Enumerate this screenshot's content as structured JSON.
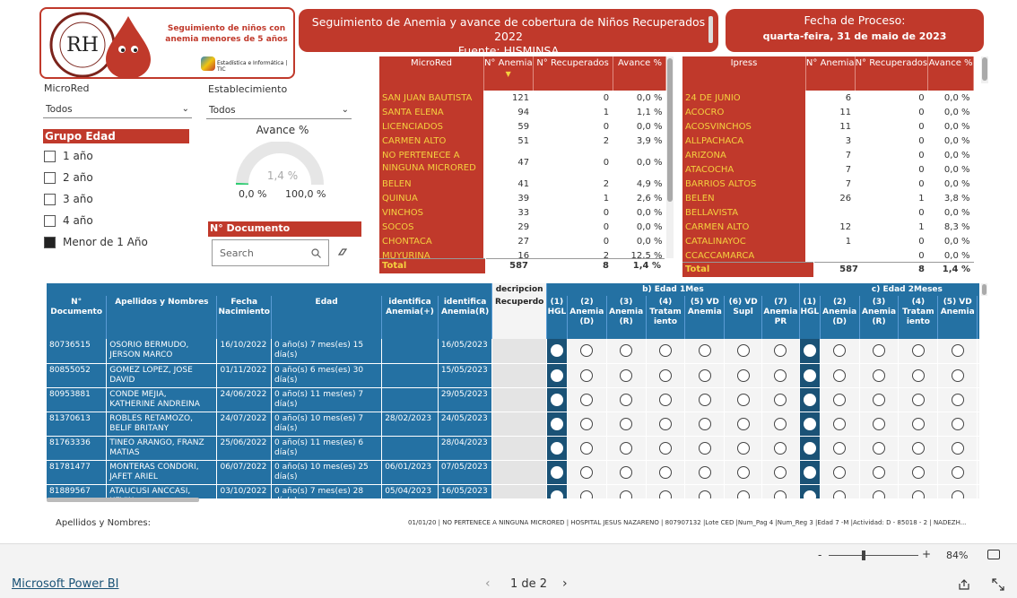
{
  "logo": {
    "ring_text": "RED DE SALUD HUAMANGA",
    "city": "AYACUCHO",
    "initials": "RH",
    "tagline": "Seguimiento de niños con anemia menores de 5 años",
    "unit": "Estadística e Informática | TIC"
  },
  "title": {
    "line1": "Seguimiento de Anemia y avance de cobertura de Niños Recuperados 2022",
    "line2": "Fuente: HISMINSA"
  },
  "process": {
    "label": "Fecha de Proceso:",
    "date": "quarta-feira, 31 de maio de 2023"
  },
  "filters": {
    "microred_label": "MicroRed",
    "microred_value": "Todos",
    "estab_label": "Establecimiento",
    "estab_value": "Todos",
    "grupo_title": "Grupo Edad",
    "grupo_items": [
      {
        "label": "1 año",
        "checked": false
      },
      {
        "label": "2 año",
        "checked": false
      },
      {
        "label": "3 año",
        "checked": false
      },
      {
        "label": "4 año",
        "checked": false
      },
      {
        "label": "Menor de 1 Año",
        "checked": true
      }
    ],
    "doc_title": "N° Documento",
    "search_placeholder": "Search"
  },
  "gauge": {
    "title": "Avance %",
    "value": "1,4 %",
    "min": "0,0 %",
    "max": "100,0 %",
    "fraction": 0.014
  },
  "microred_table": {
    "headers": [
      "MicroRed",
      "N° Anemia",
      "N° Recuperados",
      "Avance %"
    ],
    "rows": [
      [
        "SAN JUAN BAUTISTA",
        "121",
        "0",
        "0,0 %"
      ],
      [
        "SANTA ELENA",
        "94",
        "1",
        "1,1 %"
      ],
      [
        "LICENCIADOS",
        "59",
        "0",
        "0,0 %"
      ],
      [
        "CARMEN ALTO",
        "51",
        "2",
        "3,9 %"
      ],
      [
        "NO PERTENECE A NINGUNA MICRORED",
        "47",
        "0",
        "0,0 %"
      ],
      [
        "BELEN",
        "41",
        "2",
        "4,9 %"
      ],
      [
        "QUINUA",
        "39",
        "1",
        "2,6 %"
      ],
      [
        "VINCHOS",
        "33",
        "0",
        "0,0 %"
      ],
      [
        "SOCOS",
        "29",
        "0",
        "0,0 %"
      ],
      [
        "CHONTACA",
        "27",
        "0",
        "0,0 %"
      ],
      [
        "MUYURINA",
        "16",
        "2",
        "12,5 %"
      ]
    ],
    "total": [
      "Total",
      "587",
      "8",
      "1,4 %"
    ]
  },
  "ipress_table": {
    "headers": [
      "Ipress",
      "N° Anemia",
      "N° Recuperados",
      "Avance %"
    ],
    "rows": [
      [
        "24 DE JUNIO",
        "6",
        "0",
        "0,0 %"
      ],
      [
        "ACOCRO",
        "11",
        "0",
        "0,0 %"
      ],
      [
        "ACOSVINCHOS",
        "11",
        "0",
        "0,0 %"
      ],
      [
        "ALLPACHACA",
        "3",
        "0",
        "0,0 %"
      ],
      [
        "ARIZONA",
        "7",
        "0",
        "0,0 %"
      ],
      [
        "ATACOCHA",
        "7",
        "0",
        "0,0 %"
      ],
      [
        "BARRIOS ALTOS",
        "7",
        "0",
        "0,0 %"
      ],
      [
        "BELEN",
        "26",
        "1",
        "3,8 %"
      ],
      [
        "BELLAVISTA",
        "",
        "0",
        "0,0 %"
      ],
      [
        "CARMEN ALTO",
        "12",
        "1",
        "8,3 %"
      ],
      [
        "CATALINAYOC",
        "1",
        "0",
        "0,0 %"
      ],
      [
        "CCACCAMARCA",
        "",
        "0",
        "0,0 %"
      ]
    ],
    "total": [
      "Total",
      "587",
      "8",
      "1,4 %"
    ]
  },
  "detail": {
    "group_headers": {
      "desc": "decripcion",
      "m1": "b) Edad 1Mes",
      "m2": "c) Edad 2Meses"
    },
    "headers": [
      "N° Documento",
      "Apellidos y Nombres",
      "Fecha Nacimiento",
      "Edad",
      "identifica Anemia(+)",
      "identifica Anemia(R)",
      "Recuperdo"
    ],
    "sub_m1": [
      "(1) HGL",
      "(2) Anemia (D)",
      "(3) Anemia (R)",
      "(4) Tratam iento",
      "(5) VD Anemia",
      "(6) VD Supl",
      "(7) Anemia PR"
    ],
    "sub_m2": [
      "(1) HGL",
      "(2) Anemia (D)",
      "(3) Anemia (R)",
      "(4) Tratam iento",
      "(5) VD Anemia",
      "(6) VD Supl"
    ],
    "rows": [
      [
        "80736515",
        "OSORIO BERMUDO, JERSON MARCO",
        "16/10/2022",
        "0 año(s) 7 mes(es) 15 día(s)",
        "",
        "16/05/2023"
      ],
      [
        "80855052",
        "GOMEZ LOPEZ, JOSE DAVID",
        "01/11/2022",
        "0 año(s) 6 mes(es) 30 día(s)",
        "",
        "15/05/2023"
      ],
      [
        "80953881",
        "CONDE MEJIA, KATHERINE ANDREINA",
        "24/06/2022",
        "0 año(s) 11 mes(es) 7 día(s)",
        "",
        "29/05/2023"
      ],
      [
        "81370613",
        "ROBLES RETAMOZO, BELIF BRITANY",
        "24/07/2022",
        "0 año(s) 10 mes(es) 7 día(s)",
        "28/02/2023",
        "24/05/2023"
      ],
      [
        "81763336",
        "TINEO ARANGO, FRANZ MATIAS",
        "25/06/2022",
        "0 año(s) 11 mes(es) 6 día(s)",
        "",
        "28/04/2023"
      ],
      [
        "81781477",
        "MONTERAS CONDORI, JAFET ARIEL",
        "06/07/2022",
        "0 año(s) 10 mes(es) 25 día(s)",
        "06/01/2023",
        "07/05/2023"
      ],
      [
        "81889567",
        "ATAUCUSI ANCCASI, KEVIN",
        "03/10/2022",
        "0 año(s) 7 mes(es) 28 día(s)",
        "05/04/2023",
        "16/05/2023"
      ]
    ]
  },
  "footer": {
    "names_label": "Apellidos y Nombres:",
    "ticker": "01/01/20 | NO PERTENECE A NINGUNA MICRORED | HOSPITAL  JESUS NAZARENO | 807907132 |Lote CED |Num_Pag 4 |Num_Reg 3 |Edad 7 -M |Actividad: D - 85018 - 2 | NADEZH..."
  },
  "bottom": {
    "brand": "Microsoft Power BI",
    "page": "1 de 2",
    "zoom": "84%",
    "zoom_minus": "-",
    "zoom_plus": "+"
  }
}
